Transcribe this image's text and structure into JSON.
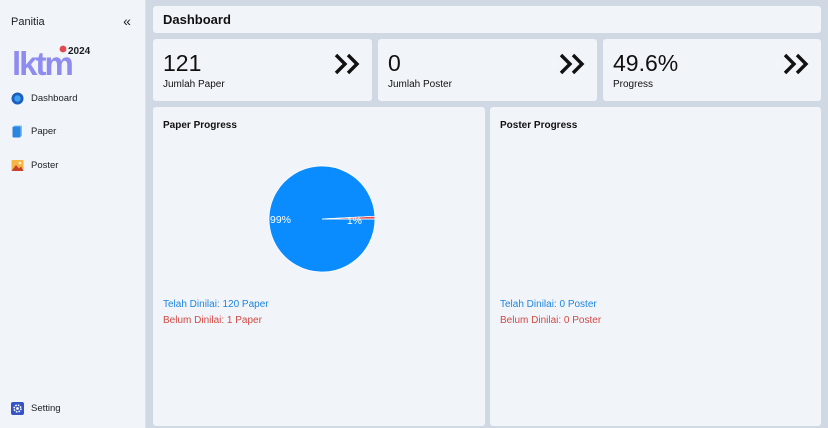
{
  "sidebar": {
    "title": "Panitia",
    "logo_text": "lktm",
    "logo_year": "2024",
    "items": [
      {
        "label": "Dashboard",
        "icon": "dashboard-icon"
      },
      {
        "label": "Paper",
        "icon": "paper-icon"
      },
      {
        "label": "Poster",
        "icon": "poster-icon"
      }
    ],
    "setting_label": "Setting"
  },
  "header": {
    "title": "Dashboard"
  },
  "stats": [
    {
      "value": "121",
      "label": "Jumlah Paper"
    },
    {
      "value": "0",
      "label": "Jumlah Poster"
    },
    {
      "value": "49.6%",
      "label": "Progress"
    }
  ],
  "paper_panel": {
    "title": "Paper Progress",
    "chart_data": {
      "type": "pie",
      "categories": [
        "Telah Dinilai",
        "Belum Dinilai"
      ],
      "values": [
        120,
        1
      ],
      "data_labels": [
        "99%",
        "1%"
      ],
      "colors": [
        "#0a8cff",
        "#e5484d"
      ]
    },
    "done_text": "Telah Dinilai: 120 Paper",
    "pending_text": "Belum Dinilai: 1 Paper"
  },
  "poster_panel": {
    "title": "Poster Progress",
    "done_text": "Telah Dinilai: 0 Poster",
    "pending_text": "Belum Dinilai: 0 Poster"
  },
  "colors": {
    "done": "#1e86e0",
    "pending": "#d24a44",
    "pie_main": "#0a8cff"
  }
}
